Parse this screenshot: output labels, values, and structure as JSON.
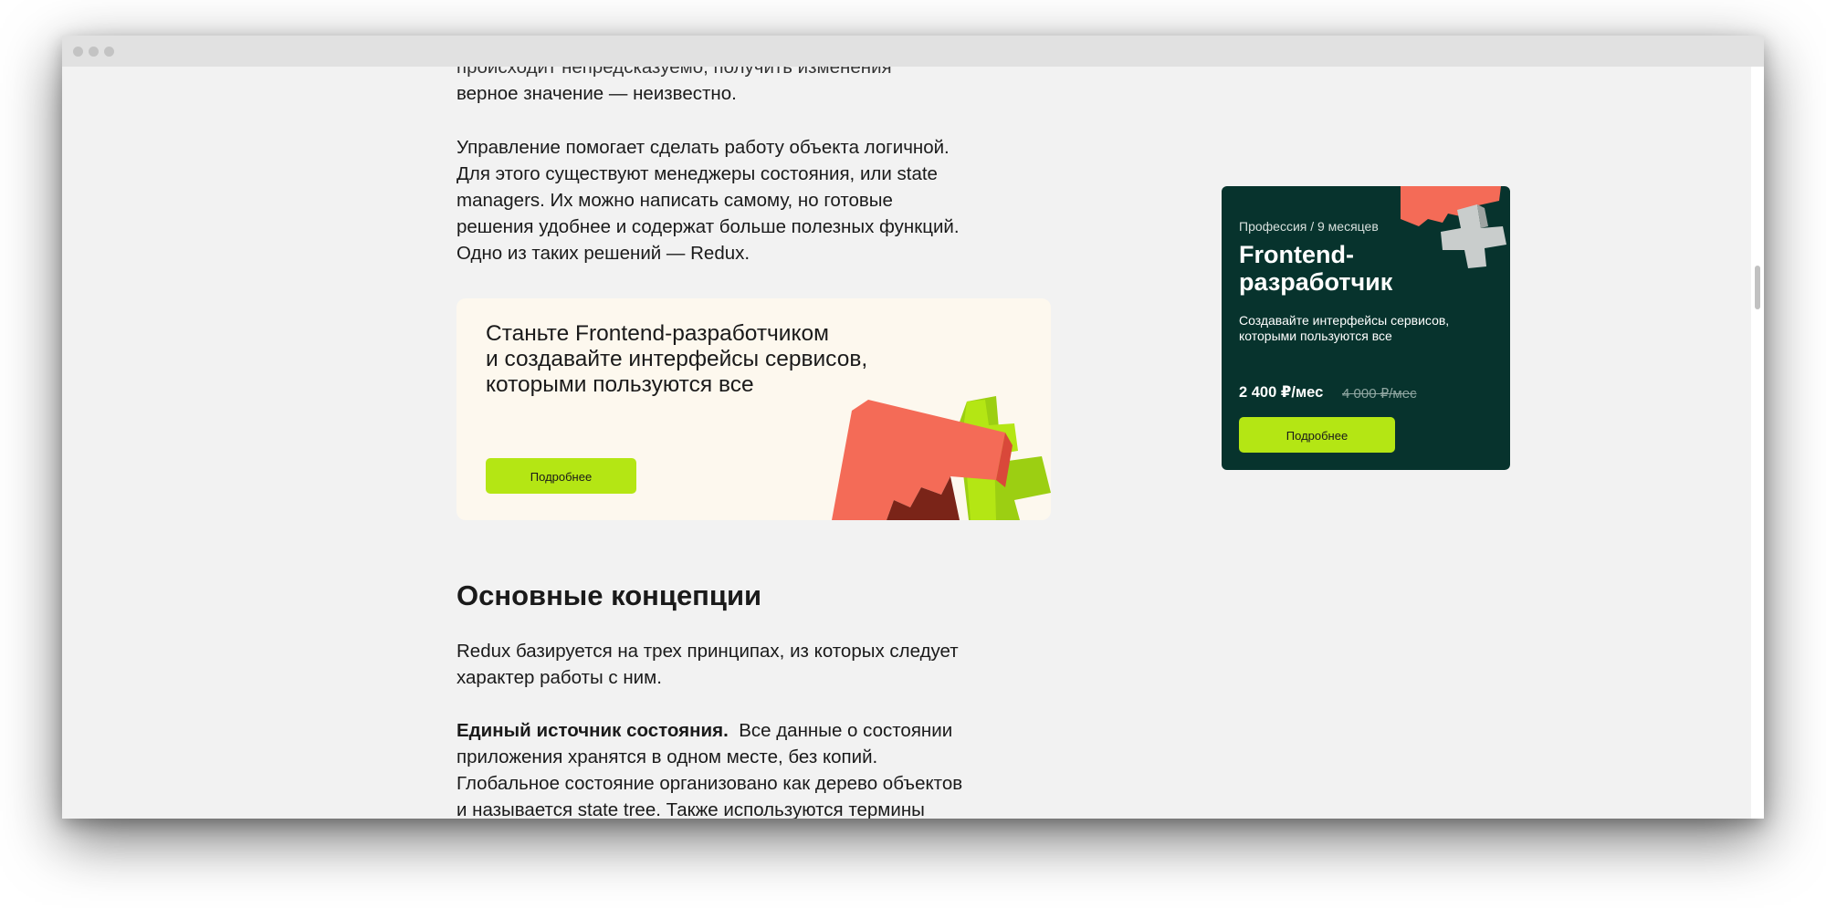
{
  "article": {
    "partial_line": "происходит непредсказуемо, получить изменения",
    "intro_line": "верное значение — неизвестно.",
    "state_managers_paragraph": [
      "Управление помогает сделать работу объекта логичной.",
      "Для этого существуют менеджеры состояния, или state",
      "managers. Их можно написать самому, но готовые",
      "решения удобнее и содержат больше полезных функций.",
      "Одно из таких решений — Redux."
    ],
    "promo": {
      "title_lines": [
        "Станьте Frontend-разработчиком",
        "и создавайте интерфейсы сервисов,",
        "которыми пользуются все"
      ],
      "button_label": "Подробнее"
    },
    "heading": "Основные концепции",
    "principles_intro": [
      "Redux базируется на трех принципах, из которых следует",
      "характер работы с ним."
    ],
    "single_source": {
      "bold": "Единый источник состояния.",
      "lines": [
        "Все данные о состоянии",
        "приложения хранятся в одном месте, без копий.",
        "Глобальное состояние организовано как дерево объектов",
        "и называется state tree. Также используются термины"
      ]
    }
  },
  "sidebar_card": {
    "meta": "Профессия / 9 месяцев",
    "title_lines": [
      "Frontend-",
      "разработчик"
    ],
    "description_lines": [
      "Создавайте интерфейсы сервисов,",
      "которыми пользуются все"
    ],
    "price": "2 400 ₽/мес",
    "old_price": "4 000 ₽/мес",
    "button_label": "Подробнее"
  },
  "colors": {
    "accent_lime": "#b4e614",
    "card_dark_green": "#07332d",
    "promo_background": "#fdf8ee",
    "coral": "#f46b57"
  }
}
